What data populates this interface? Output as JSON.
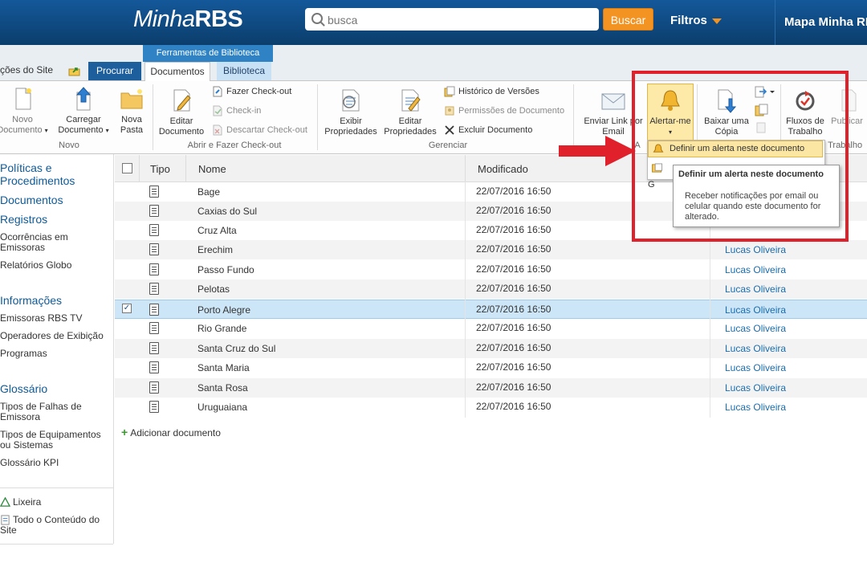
{
  "header": {
    "logo_prefix": "Minha",
    "logo_suffix": "RBS",
    "search_placeholder": "busca",
    "search_button": "Buscar",
    "filters_label": "Filtros",
    "mapa_label": "Mapa Minha RBS"
  },
  "tabs": {
    "site_actions": "ções do Site",
    "procurar": "Procurar",
    "tool_group": "Ferramentas de Biblioteca",
    "documentos": "Documentos",
    "biblioteca": "Biblioteca"
  },
  "ribbon": {
    "novo_documento_l1": "Novo",
    "novo_documento_l2": "Documento",
    "carregar_l1": "Carregar",
    "carregar_l2": "Documento",
    "nova_pasta_l1": "Nova",
    "nova_pasta_l2": "Pasta",
    "group_novo": "Novo",
    "editar_l1": "Editar",
    "editar_l2": "Documento",
    "checkout": "Fazer Check-out",
    "checkin": "Check-in",
    "descartar": "Descartar Check-out",
    "group_checkout": "Abrir e Fazer Check-out",
    "exibir_l1": "Exibir",
    "exibir_l2": "Propriedades",
    "editarprop_l1": "Editar",
    "editarprop_l2": "Propriedades",
    "historico": "Histórico de Versões",
    "permissoes": "Permissões de Documento",
    "excluir": "Excluir Documento",
    "group_gerenciar": "Gerenciar",
    "enviar_l1": "Enviar Link por",
    "enviar_l2": "Email",
    "alertar": "Alertar-me",
    "group_compart": "A",
    "baixar_l1": "Baixar uma",
    "baixar_l2": "Cópia",
    "fluxos_l1": "Fluxos de",
    "fluxos_l2": "Trabalho",
    "publicar": "Publicar",
    "group_fluxos": "de Trabalho"
  },
  "alert_menu": {
    "item1": "Definir um alerta neste documento",
    "item2": "G"
  },
  "tooltip": {
    "title": "Definir um alerta neste documento",
    "body": "Receber notificações por email ou celular quando este documento for alterado."
  },
  "leftnav": {
    "politicas_l1": "Políticas e",
    "politicas_l2": "Procedimentos",
    "documentos": "Documentos",
    "registros": "Registros",
    "ocorrencias_l1": "Ocorrências em",
    "ocorrencias_l2": "Emissoras",
    "relatorios": "Relatórios Globo",
    "informacoes": "Informações",
    "emissoras": "Emissoras RBS TV",
    "operadores": "Operadores de Exibição",
    "programas": "Programas",
    "glossario": "Glossário",
    "tipos_falhas_l1": "Tipos de Falhas de",
    "tipos_falhas_l2": "Emissora",
    "tipos_equip_l1": "Tipos de Equipamentos",
    "tipos_equip_l2": "ou Sistemas",
    "glossario_kpi": "Glossário KPI",
    "lixeira": "Lixeira",
    "todo_l1": "Todo o Conteúdo do",
    "todo_l2": "Site"
  },
  "list": {
    "col_tipo": "Tipo",
    "col_nome": "Nome",
    "col_modificado": "Modificado",
    "rows": [
      {
        "name": "Bage",
        "modified": "22/07/2016 16:50",
        "author": ""
      },
      {
        "name": "Caxias do Sul",
        "modified": "22/07/2016 16:50",
        "author": ""
      },
      {
        "name": "Cruz Alta",
        "modified": "22/07/2016 16:50",
        "author": ""
      },
      {
        "name": "Erechim",
        "modified": "22/07/2016 16:50",
        "author": "Lucas Oliveira"
      },
      {
        "name": "Passo Fundo",
        "modified": "22/07/2016 16:50",
        "author": "Lucas Oliveira"
      },
      {
        "name": "Pelotas",
        "modified": "22/07/2016 16:50",
        "author": "Lucas Oliveira"
      },
      {
        "name": "Porto Alegre",
        "modified": "22/07/2016 16:50",
        "author": "Lucas Oliveira"
      },
      {
        "name": "Rio Grande",
        "modified": "22/07/2016 16:50",
        "author": "Lucas Oliveira"
      },
      {
        "name": "Santa Cruz do Sul",
        "modified": "22/07/2016 16:50",
        "author": "Lucas Oliveira"
      },
      {
        "name": "Santa Maria",
        "modified": "22/07/2016 16:50",
        "author": "Lucas Oliveira"
      },
      {
        "name": "Santa Rosa",
        "modified": "22/07/2016 16:50",
        "author": "Lucas Oliveira"
      },
      {
        "name": "Uruguaiana",
        "modified": "22/07/2016 16:50",
        "author": "Lucas Oliveira"
      }
    ],
    "add_document": "Adicionar documento"
  },
  "colors": {
    "header_blue": "#0f4a7e",
    "accent_orange": "#f39322",
    "link_blue": "#1a6db0",
    "selection": "#cde6f7",
    "annotation_red": "#e0202a"
  },
  "icons": [
    "search-icon",
    "filters-caret-icon",
    "new-document-icon",
    "upload-icon",
    "folder-icon",
    "edit-document-icon",
    "checkout-icon",
    "properties-icon",
    "version-history-icon",
    "permissions-icon",
    "delete-icon",
    "email-icon",
    "bell-icon",
    "download-copy-icon",
    "workflow-icon",
    "document-icon",
    "add-icon",
    "recycle-bin-icon",
    "site-content-icon"
  ]
}
